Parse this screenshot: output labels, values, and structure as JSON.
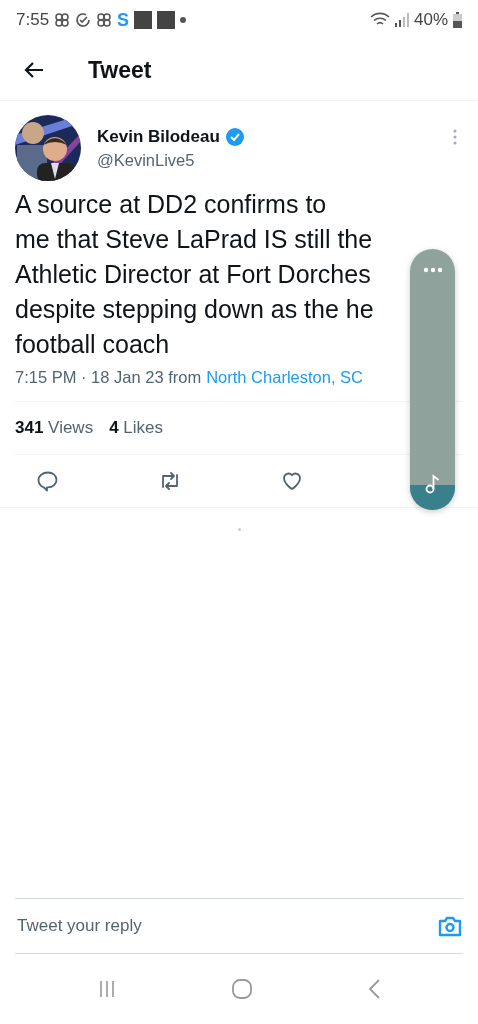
{
  "status_bar": {
    "time": "7:55",
    "app_letter": "S",
    "battery": "40%"
  },
  "header": {
    "title": "Tweet"
  },
  "tweet": {
    "author": {
      "name": "Kevin Bilodeau",
      "verified": true,
      "handle": "@KevinLive5"
    },
    "lines": [
      "A source at DD2 confirms to",
      "me that Steve LaPrad IS still the",
      "Athletic Director at Fort Dorches",
      "despite stepping down as the he",
      "football coach"
    ],
    "time": "7:15 PM · 18 Jan 23 from",
    "location": "North Charleston, SC",
    "stats": [
      {
        "count": "341",
        "label": "Views"
      },
      {
        "count": "4",
        "label": "Likes"
      }
    ],
    "actions": [
      {
        "kind": "reply"
      },
      {
        "kind": "retweet"
      },
      {
        "kind": "like"
      }
    ]
  },
  "reply_bar": {
    "placeholder": "Tweet your reply"
  }
}
